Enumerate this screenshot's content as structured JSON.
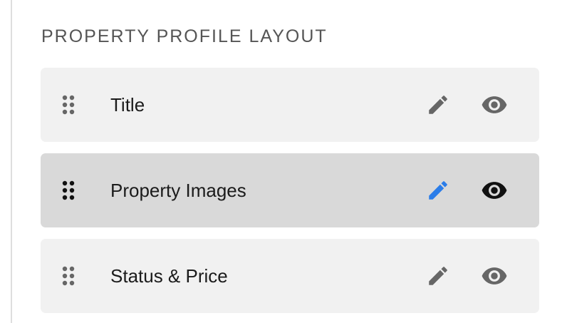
{
  "section": {
    "title": "PROPERTY PROFILE LAYOUT"
  },
  "rows": [
    {
      "label": "Title",
      "state": "normal",
      "handle_icon": "drag-handle-icon",
      "edit_icon": "pencil-icon",
      "view_icon": "eye-icon"
    },
    {
      "label": "Property Images",
      "state": "selected",
      "handle_icon": "drag-handle-icon",
      "edit_icon": "pencil-icon",
      "view_icon": "eye-icon"
    },
    {
      "label": "Status & Price",
      "state": "normal",
      "handle_icon": "drag-handle-icon",
      "edit_icon": "pencil-icon",
      "view_icon": "eye-icon"
    }
  ],
  "colors": {
    "row_background": "#f1f1f1",
    "row_selected_background": "#d9d9d9",
    "icon_default": "#666666",
    "icon_selected_edit": "#2b7de9",
    "icon_selected_view": "#111111",
    "title_text": "#555555",
    "label_text": "#1b1b1b"
  }
}
